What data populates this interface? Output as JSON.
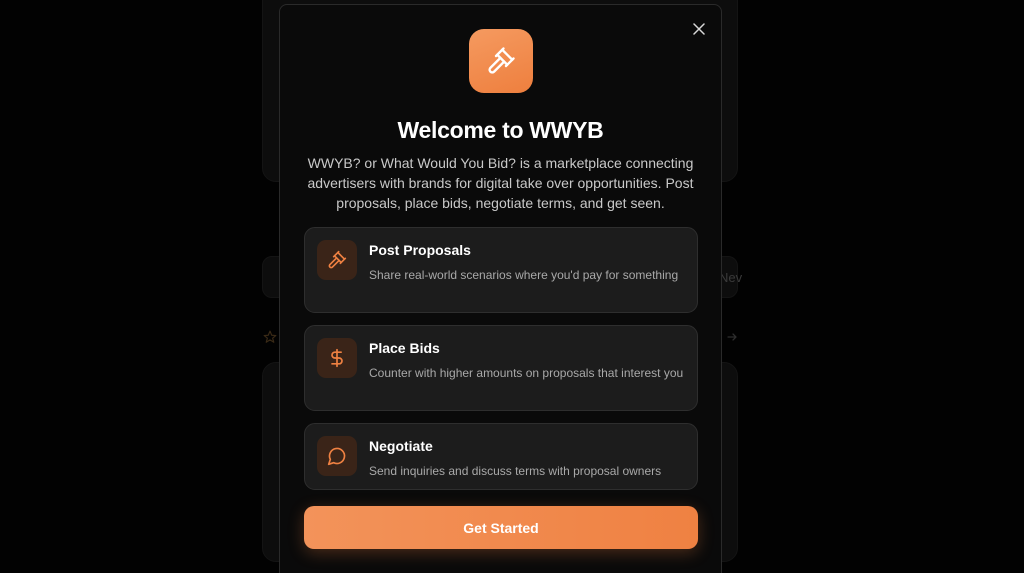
{
  "background": {
    "partial_text": "Nev"
  },
  "modal": {
    "title": "Welcome to WWYB",
    "description": "WWYB? or What Would You Bid? is a marketplace connecting advertisers with brands for digital take over opportunities. Post proposals, place bids, negotiate terms, and get seen.",
    "logo_icon": "gavel-icon",
    "close_icon": "close-icon",
    "features": [
      {
        "title": "Post Proposals",
        "description": "Share real-world scenarios where you'd pay for something",
        "icon": "gavel-icon"
      },
      {
        "title": "Place Bids",
        "description": "Counter with higher amounts on proposals that interest you",
        "icon": "dollar-icon"
      },
      {
        "title": "Negotiate",
        "description": "Send inquiries and discuss terms with proposal owners",
        "icon": "chat-bubble-icon"
      }
    ],
    "cta_label": "Get Started"
  },
  "colors": {
    "accent": "#ef8142",
    "accent_light": "#f59a60",
    "background": "#0a0a0a",
    "card": "#1c1c1c"
  }
}
